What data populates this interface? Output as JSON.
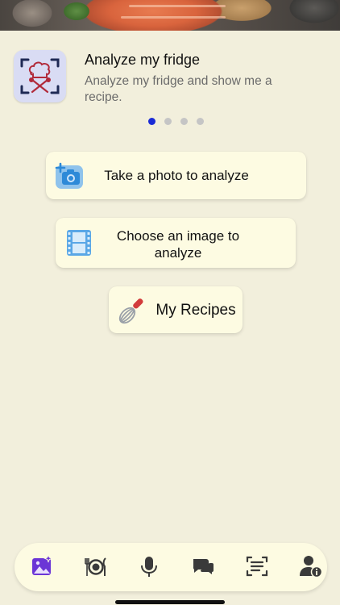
{
  "feature": {
    "title": "Analyze my fridge",
    "subtitle": "Analyze my fridge and show me a recipe.",
    "logo_icon": "chef-scan-icon"
  },
  "carousel": {
    "pages": 4,
    "active_index": 0,
    "active_color": "#1a2bd6",
    "inactive_color": "#c5c5c5"
  },
  "actions": {
    "take_photo": {
      "label": "Take a photo to analyze",
      "icon": "camera-add-icon"
    },
    "choose_image": {
      "label": "Choose an image to analyze",
      "icon": "film-icon"
    },
    "my_recipes": {
      "label": "My Recipes",
      "icon": "whisk-icon"
    }
  },
  "tabbar": {
    "items": [
      {
        "icon": "image-sparkle-icon",
        "active": true
      },
      {
        "icon": "plate-utensils-icon",
        "active": false
      },
      {
        "icon": "microphone-icon",
        "active": false
      },
      {
        "icon": "chat-bubbles-icon",
        "active": false
      },
      {
        "icon": "document-scan-icon",
        "active": false
      },
      {
        "icon": "person-info-icon",
        "active": false
      }
    ],
    "active_color": "#6b35d6",
    "inactive_color": "#3a3a3a"
  }
}
